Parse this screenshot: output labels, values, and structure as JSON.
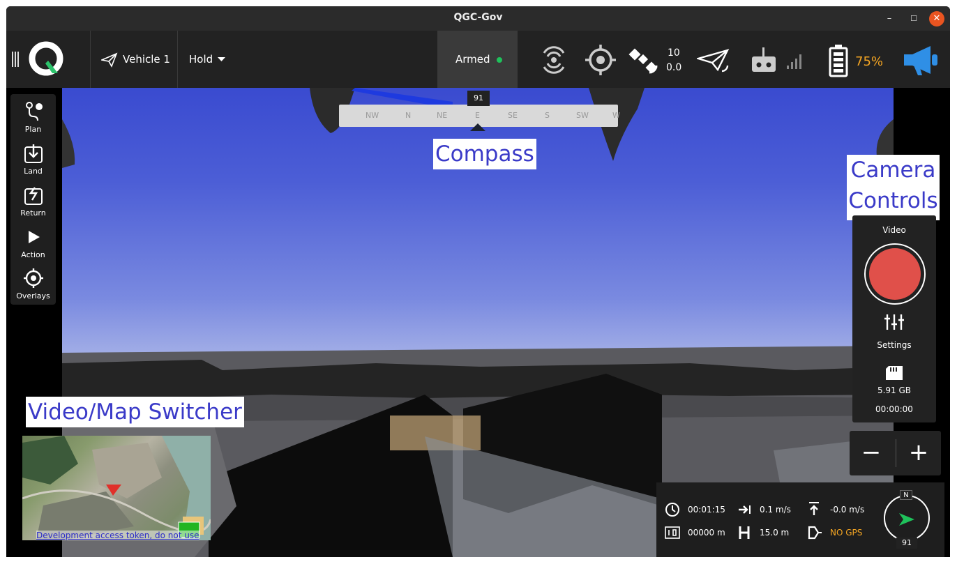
{
  "window": {
    "title": "QGC-Gov",
    "minimize": "–",
    "maximize": "☐",
    "close": "✕"
  },
  "toolbar": {
    "vehicle_label": "Vehicle 1",
    "flight_mode": "Hold",
    "armed_label": "Armed",
    "gps_count": "10",
    "gps_hdop": "0.0",
    "battery_pct": "75%",
    "armed_color": "#1fc15b",
    "battery_color": "#f5a623",
    "announce_color": "#2f8fe6"
  },
  "tools": [
    {
      "label": "Plan",
      "icon": "plan-icon"
    },
    {
      "label": "Land",
      "icon": "land-icon"
    },
    {
      "label": "Return",
      "icon": "return-icon"
    },
    {
      "label": "Action",
      "icon": "play-icon"
    },
    {
      "label": "Overlays",
      "icon": "overlays-icon"
    }
  ],
  "compass": {
    "heading": "91",
    "directions": [
      "NW",
      "N",
      "NE",
      "E",
      "SE",
      "S",
      "SW",
      "W"
    ]
  },
  "annotations": {
    "compass": "Compass",
    "camera_line1": "Camera",
    "camera_line2": "Controls",
    "switcher": "Video/Map Switcher"
  },
  "camera": {
    "mode": "Video",
    "settings_label": "Settings",
    "storage": "5.91 GB",
    "rec_time": "00:00:00",
    "record_color": "#e0504a"
  },
  "zoom": {
    "minus": "−",
    "plus": "+"
  },
  "instruments": {
    "flight_time": "00:01:15",
    "ground_speed": "0.1 m/s",
    "vertical_speed": "-0.0 m/s",
    "distance": "00000 m",
    "altitude": "15.0 m",
    "gps_status": "NO GPS",
    "north": "N",
    "heading": "91",
    "gps_status_color": "#f5a623"
  },
  "map": {
    "attribution": "Development access token, do not use"
  }
}
